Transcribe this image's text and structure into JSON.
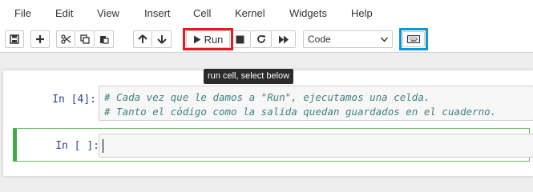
{
  "menubar": {
    "items": [
      "File",
      "Edit",
      "View",
      "Insert",
      "Cell",
      "Kernel",
      "Widgets",
      "Help"
    ]
  },
  "toolbar": {
    "run_label": "Run",
    "cell_type": {
      "selected": "Code"
    },
    "icons": [
      "save-icon",
      "plus-icon",
      "scissors-icon",
      "copy-icon",
      "paste-icon",
      "arrow-up-icon",
      "arrow-down-icon",
      "play-icon",
      "stop-icon",
      "restart-icon",
      "fast-forward-icon",
      "chevron-down-icon",
      "keyboard-icon"
    ],
    "highlight_colors": {
      "run": "#e11b22",
      "keyboard": "#1196d5"
    }
  },
  "tooltip": {
    "text": "run cell, select below"
  },
  "cells": [
    {
      "prompt": "In [4]:",
      "lines": [
        "# Cada vez que le damos a \"Run\", ejecutamos una celda.",
        "# Tanto el código como la salida quedan guardados en el cuaderno."
      ]
    },
    {
      "prompt": "In [ ]:",
      "lines": [],
      "selected": true
    }
  ],
  "colors": {
    "prompt": "#303f9f",
    "comment": "#408080",
    "selected_border": "#42a84a"
  }
}
